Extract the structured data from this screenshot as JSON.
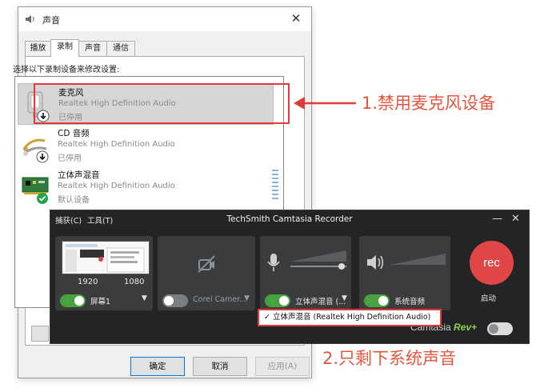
{
  "sound_dialog": {
    "title": "声音",
    "close_glyph": "✕",
    "tabs": [
      {
        "label": "播放",
        "active": false
      },
      {
        "label": "录制",
        "active": true
      },
      {
        "label": "声音",
        "active": false
      },
      {
        "label": "通信",
        "active": false
      }
    ],
    "instruction": "选择以下录制设备来修改设置:",
    "devices": [
      {
        "name": "麦克风",
        "driver": "Realtek High Definition Audio",
        "status": "已停用",
        "icon": "microphone-icon",
        "badge": "disabled-arrow-icon",
        "selected": true
      },
      {
        "name": "CD 音频",
        "driver": "Realtek High Definition Audio",
        "status": "已停用",
        "icon": "cd-audio-icon",
        "badge": "disabled-arrow-icon",
        "selected": false
      },
      {
        "name": "立体声混音",
        "driver": "Realtek High Definition Audio",
        "status": "默认设备",
        "icon": "soundcard-icon",
        "badge": "default-check-icon",
        "selected": false
      }
    ],
    "buttons": {
      "ok": "确定",
      "cancel": "取消",
      "apply": "应用(A)"
    }
  },
  "annotations": {
    "step1": "1.禁用麦克风设备",
    "step2": "2.只剩下系统声音"
  },
  "recorder": {
    "menu": [
      "捕获(C)",
      "工具(T)"
    ],
    "title": "TechSmith Camtasia Recorder",
    "minimize_glyph": "—",
    "close_glyph": "✕",
    "screen": {
      "width": "1920",
      "height": "1080",
      "label": "屏幕1",
      "enabled": true
    },
    "camera": {
      "label": "Corel Camer...",
      "enabled": false
    },
    "audio": {
      "label": "立体声混音 (...",
      "enabled": true
    },
    "system_audio": {
      "label": "系统音频",
      "enabled": true
    },
    "rec_label": "rec",
    "start_label": "启动",
    "rev_brand": "Camtasia",
    "rev_suffix": "Rev",
    "rev_plus": "+",
    "dropdown_check": "✓",
    "dropdown_item": "立体声混音 (Realtek High Definition Audio)"
  },
  "colors": {
    "accent_red": "#e03a3a",
    "annotation_text": "#e6553f",
    "toggle_on": "#46a340",
    "rec_button": "#e14646",
    "recorder_bg": "#232425"
  }
}
